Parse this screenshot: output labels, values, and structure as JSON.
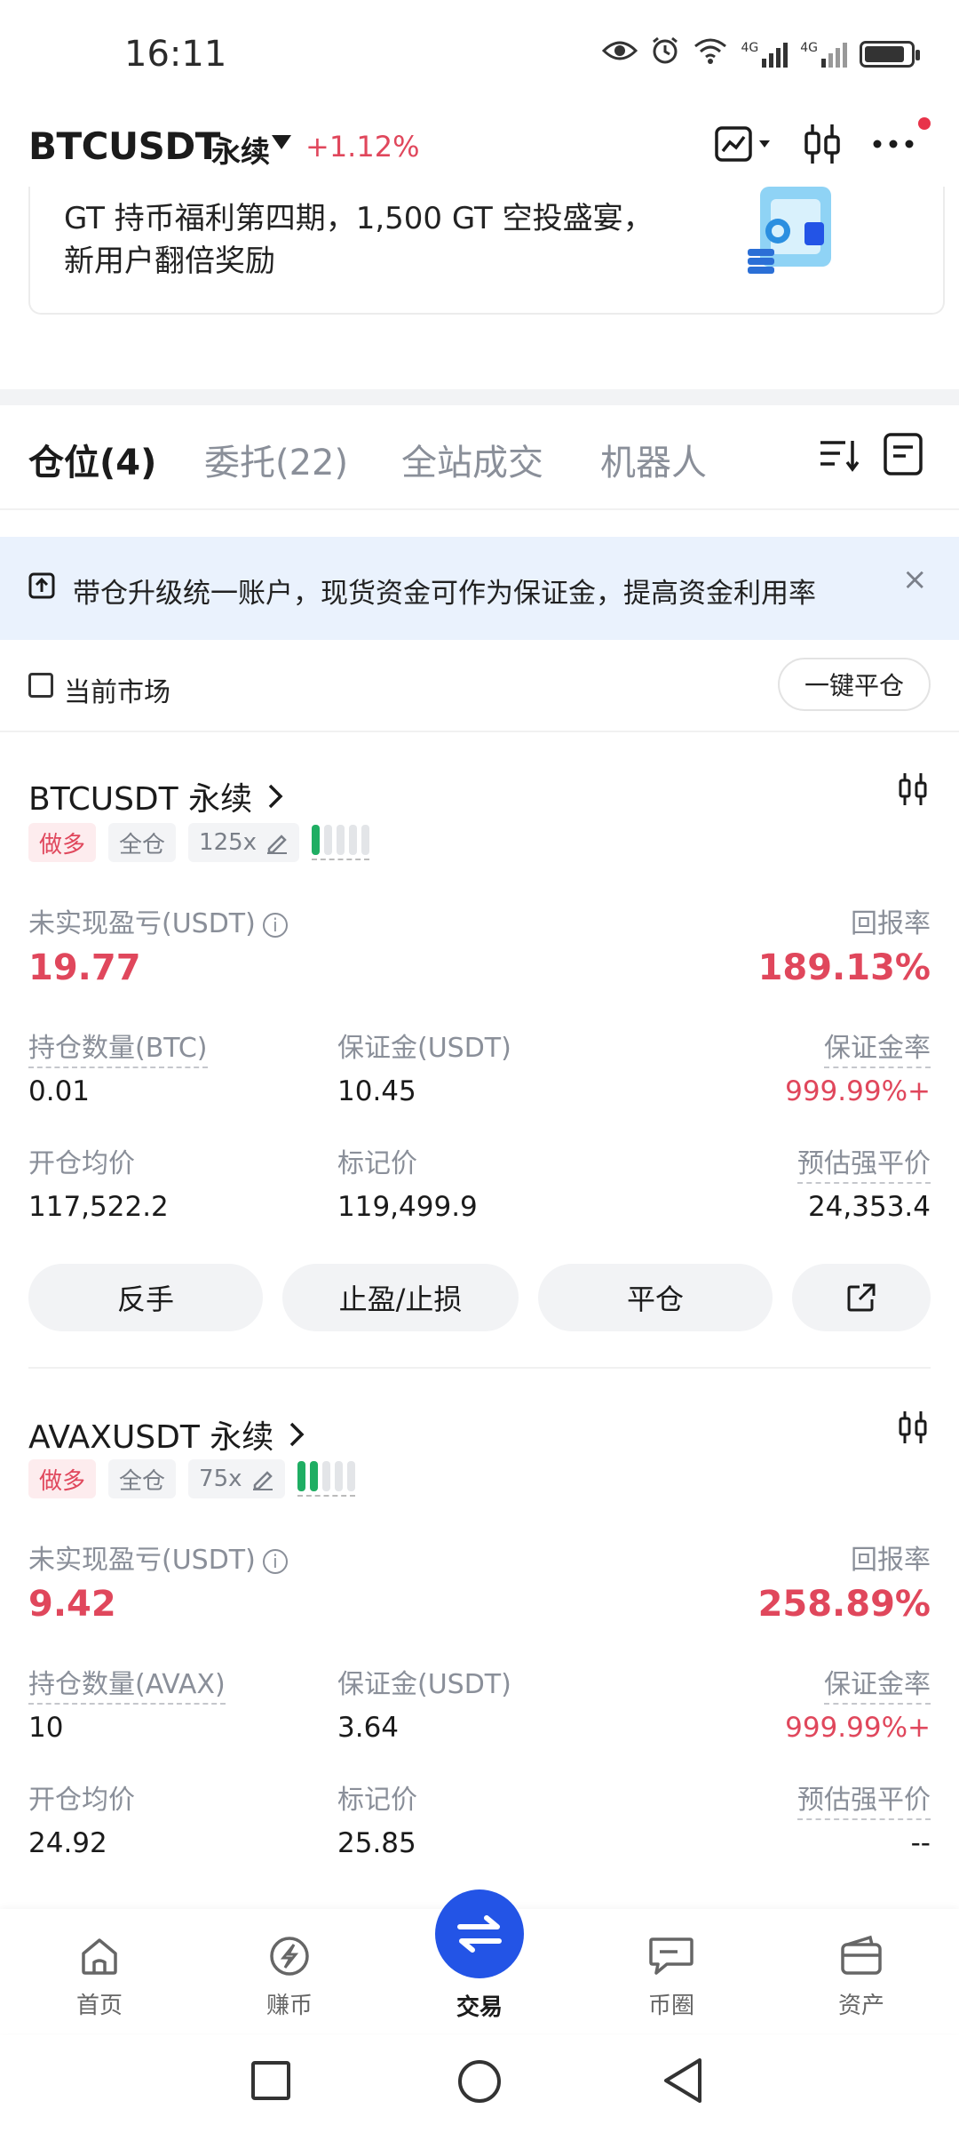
{
  "status_bar": {
    "time": "16:11",
    "net1": "4G",
    "net2": "4G"
  },
  "header": {
    "symbol": "BTCUSDT",
    "contract": "永续",
    "change": "+1.12%"
  },
  "banner": {
    "line1": "GT 持币福利第四期，1,500 GT 空投盛宴，",
    "line2": "新用户翻倍奖励"
  },
  "tabs": [
    {
      "label": "仓位(4)",
      "active": true
    },
    {
      "label": "委托(22)",
      "active": false
    },
    {
      "label": "全站成交",
      "active": false
    },
    {
      "label": "机器人",
      "active": false
    }
  ],
  "notice": {
    "text": "带仓升级统一账户，现货资金可作为保证金，提高资金利用率",
    "close": "×"
  },
  "filter": {
    "current_market_label": "当前市场",
    "close_all_label": "一键平仓"
  },
  "positions": [
    {
      "title": "BTCUSDT 永续",
      "tags": [
        "做多",
        "全仓",
        "125x"
      ],
      "leverage_level": 1,
      "pnl_label": "未实现盈亏(USDT)",
      "pnl_value": "19.77",
      "roe_label": "回报率",
      "roe_value": "189.13%",
      "size_label": "持仓数量(BTC)",
      "size_value": "0.01",
      "margin_label": "保证金(USDT)",
      "margin_value": "10.45",
      "margin_rate_label": "保证金率",
      "margin_rate_value": "999.99%+",
      "entry_label": "开仓均价",
      "entry_value": "117,522.2",
      "mark_label": "标记价",
      "mark_value": "119,499.9",
      "liq_label": "预估强平价",
      "liq_value": "24,353.4",
      "actions": [
        "反手",
        "止盈/止损",
        "平仓"
      ]
    },
    {
      "title": "AVAXUSDT 永续",
      "tags": [
        "做多",
        "全仓",
        "75x"
      ],
      "leverage_level": 2,
      "pnl_label": "未实现盈亏(USDT)",
      "pnl_value": "9.42",
      "roe_label": "回报率",
      "roe_value": "258.89%",
      "size_label": "持仓数量(AVAX)",
      "size_value": "10",
      "margin_label": "保证金(USDT)",
      "margin_value": "3.64",
      "margin_rate_label": "保证金率",
      "margin_rate_value": "999.99%+",
      "entry_label": "开仓均价",
      "entry_value": "24.92",
      "mark_label": "标记价",
      "mark_value": "25.85",
      "liq_label": "预估强平价",
      "liq_value": "--"
    }
  ],
  "bottom_nav": [
    {
      "label": "首页",
      "icon": "home-icon"
    },
    {
      "label": "赚币",
      "icon": "earn-icon"
    },
    {
      "label": "交易",
      "icon": "swap-icon",
      "active": true
    },
    {
      "label": "币圈",
      "icon": "chat-icon"
    },
    {
      "label": "资产",
      "icon": "wallet-icon"
    }
  ],
  "colors": {
    "accent": "#2354e6",
    "loss_profit_red": "#e0475c",
    "long_green": "#1fae63"
  }
}
